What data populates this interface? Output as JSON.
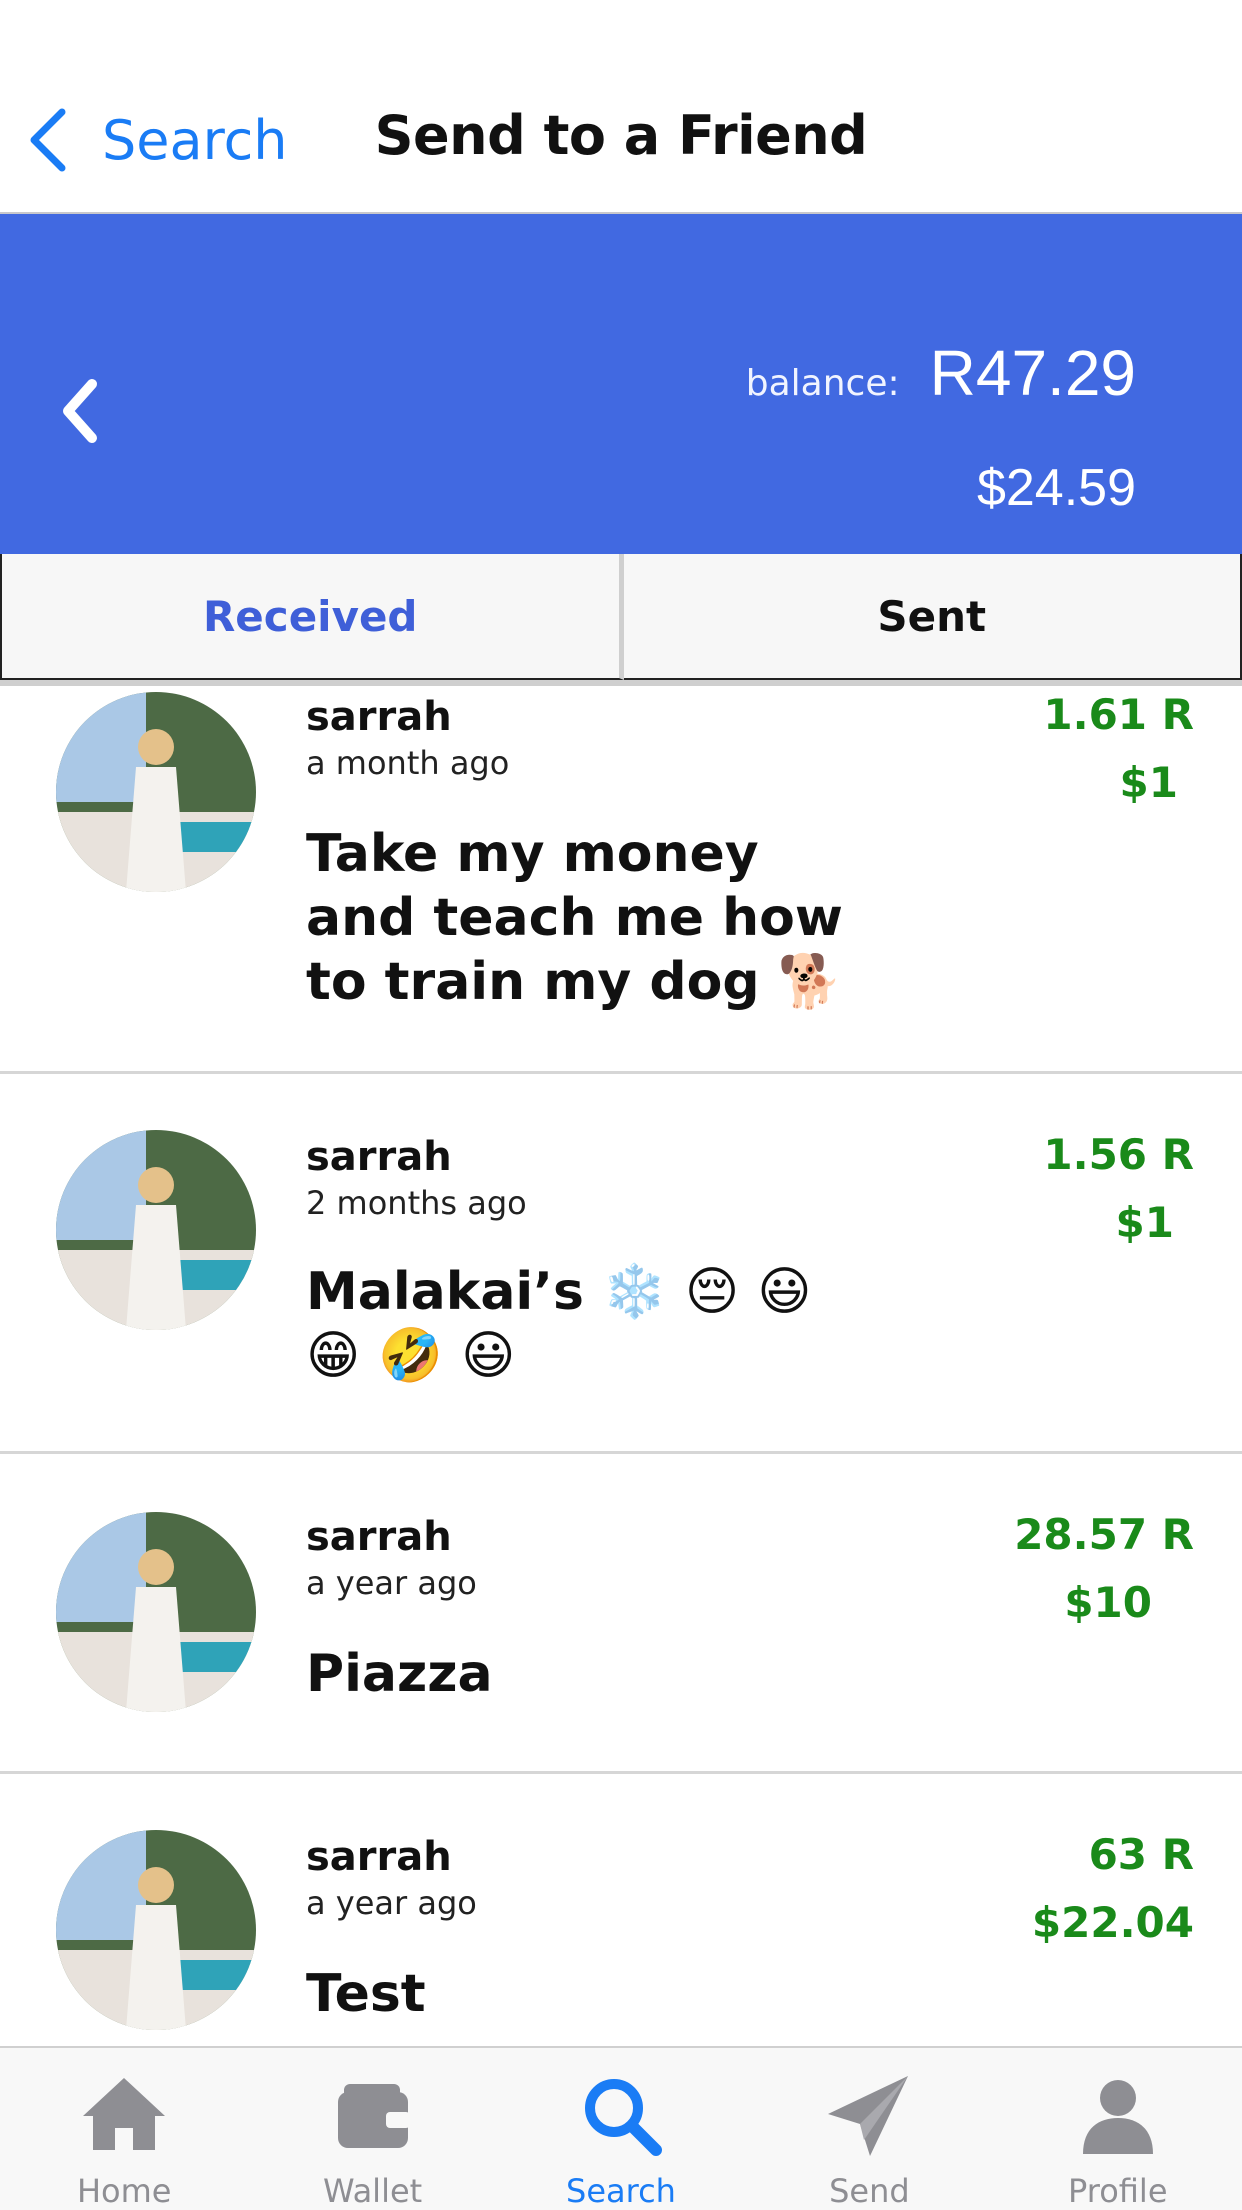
{
  "navbar": {
    "back_label": "Search",
    "title": "Send to a Friend"
  },
  "balance": {
    "label": "balance:",
    "amount": "R47.29",
    "usd": "$24.59"
  },
  "tabs": [
    {
      "label": "Received",
      "active": true
    },
    {
      "label": "Sent",
      "active": false
    }
  ],
  "transactions": [
    {
      "name": "sarrah",
      "time": "a month ago",
      "message": "Take my money and teach me how to train my dog 🐕",
      "rand": "1.61 R",
      "usd": "$1"
    },
    {
      "name": "sarrah",
      "time": "2 months ago",
      "message": "Malakai’s ❄️ 😔 😃 😁 🤣 😃",
      "rand": "1.56 R",
      "usd": "$1"
    },
    {
      "name": "sarrah",
      "time": "a year ago",
      "message": "Piazza",
      "rand": "28.57 R",
      "usd": "$10"
    },
    {
      "name": "sarrah",
      "time": "a year ago",
      "message": "Test",
      "rand": "63 R",
      "usd": "$22.04"
    }
  ],
  "tabbar": [
    {
      "label": "Home",
      "icon": "home-icon",
      "active": false
    },
    {
      "label": "Wallet",
      "icon": "wallet-icon",
      "active": false
    },
    {
      "label": "Search",
      "icon": "search-icon",
      "active": true
    },
    {
      "label": "Send",
      "icon": "send-icon",
      "active": false
    },
    {
      "label": "Profile",
      "icon": "profile-icon",
      "active": false
    }
  ],
  "colors": {
    "accent": "#1a7cf5",
    "panel": "#4169e1",
    "amount_green": "#1a8a1a",
    "tab_active": "#3f5fd8"
  }
}
